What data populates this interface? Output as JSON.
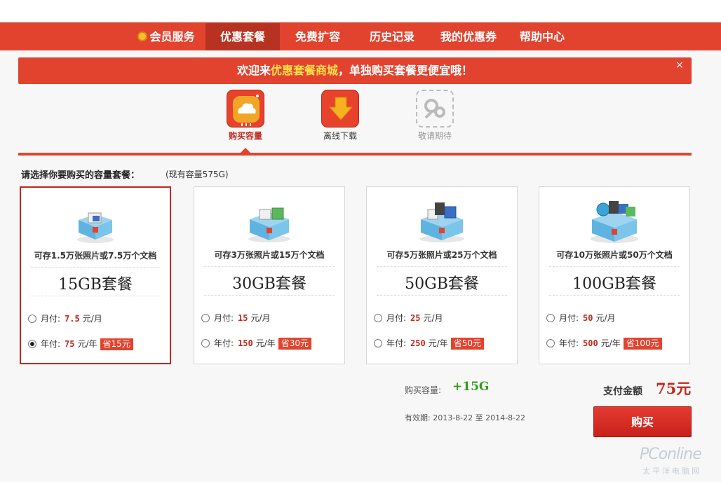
{
  "nav": {
    "items": [
      {
        "label": "会员服务"
      },
      {
        "label": "优惠套餐"
      },
      {
        "label": "免费扩容"
      },
      {
        "label": "历史记录"
      },
      {
        "label": "我的优惠券"
      },
      {
        "label": "帮助中心"
      }
    ],
    "active_index": 1
  },
  "banner": {
    "prefix": "欢迎来",
    "highlight": "优惠套餐商城",
    "suffix": "，单独购买套餐更便宜哦！",
    "close": "×"
  },
  "tools": [
    {
      "label": "购买容量",
      "icon": "cloud-icon",
      "state": "active"
    },
    {
      "label": "离线下载",
      "icon": "download-arrow-icon",
      "state": "normal"
    },
    {
      "label": "敬请期待",
      "icon": "coming-soon-icon",
      "state": "disabled"
    }
  ],
  "selection": {
    "label": "请选择你要购买的容量套餐：",
    "current": "(现有容量575G)"
  },
  "packages": [
    {
      "desc": "可存1.5万张照片或7.5万个文档",
      "size": "15GB套餐",
      "monthly_label": "月付:",
      "monthly_price": "7.5",
      "monthly_unit": "元/月",
      "yearly_label": "年付:",
      "yearly_price": "75",
      "yearly_unit": "元/年",
      "save": "省15元",
      "selected": true
    },
    {
      "desc": "可存3万张照片或15万个文档",
      "size": "30GB套餐",
      "monthly_label": "月付:",
      "monthly_price": "15",
      "monthly_unit": "元/月",
      "yearly_label": "年付:",
      "yearly_price": "150",
      "yearly_unit": "元/年",
      "save": "省30元",
      "selected": false
    },
    {
      "desc": "可存5万张照片或25万个文档",
      "size": "50GB套餐",
      "monthly_label": "月付:",
      "monthly_price": "25",
      "monthly_unit": "元/月",
      "yearly_label": "年付:",
      "yearly_price": "250",
      "yearly_unit": "元/年",
      "save": "省50元",
      "selected": false
    },
    {
      "desc": "可存10万张照片或50万个文档",
      "size": "100GB套餐",
      "monthly_label": "月付:",
      "monthly_price": "50",
      "monthly_unit": "元/月",
      "yearly_label": "年付:",
      "yearly_price": "500",
      "yearly_unit": "元/年",
      "save": "省100元",
      "selected": false
    }
  ],
  "summary": {
    "capacity_label": "购买容量:",
    "capacity_value": "+15G",
    "validity": "有效期: 2013-8-22 至 2014-8-22",
    "pay_label": "支付金额",
    "pay_amount": "75元",
    "buy_label": "购买"
  },
  "watermark": {
    "text": "PConline",
    "sub": "太平洋电脑网"
  },
  "colors": {
    "accent": "#e2432f",
    "price": "#c0271c",
    "capacity": "#3a9a1d"
  }
}
